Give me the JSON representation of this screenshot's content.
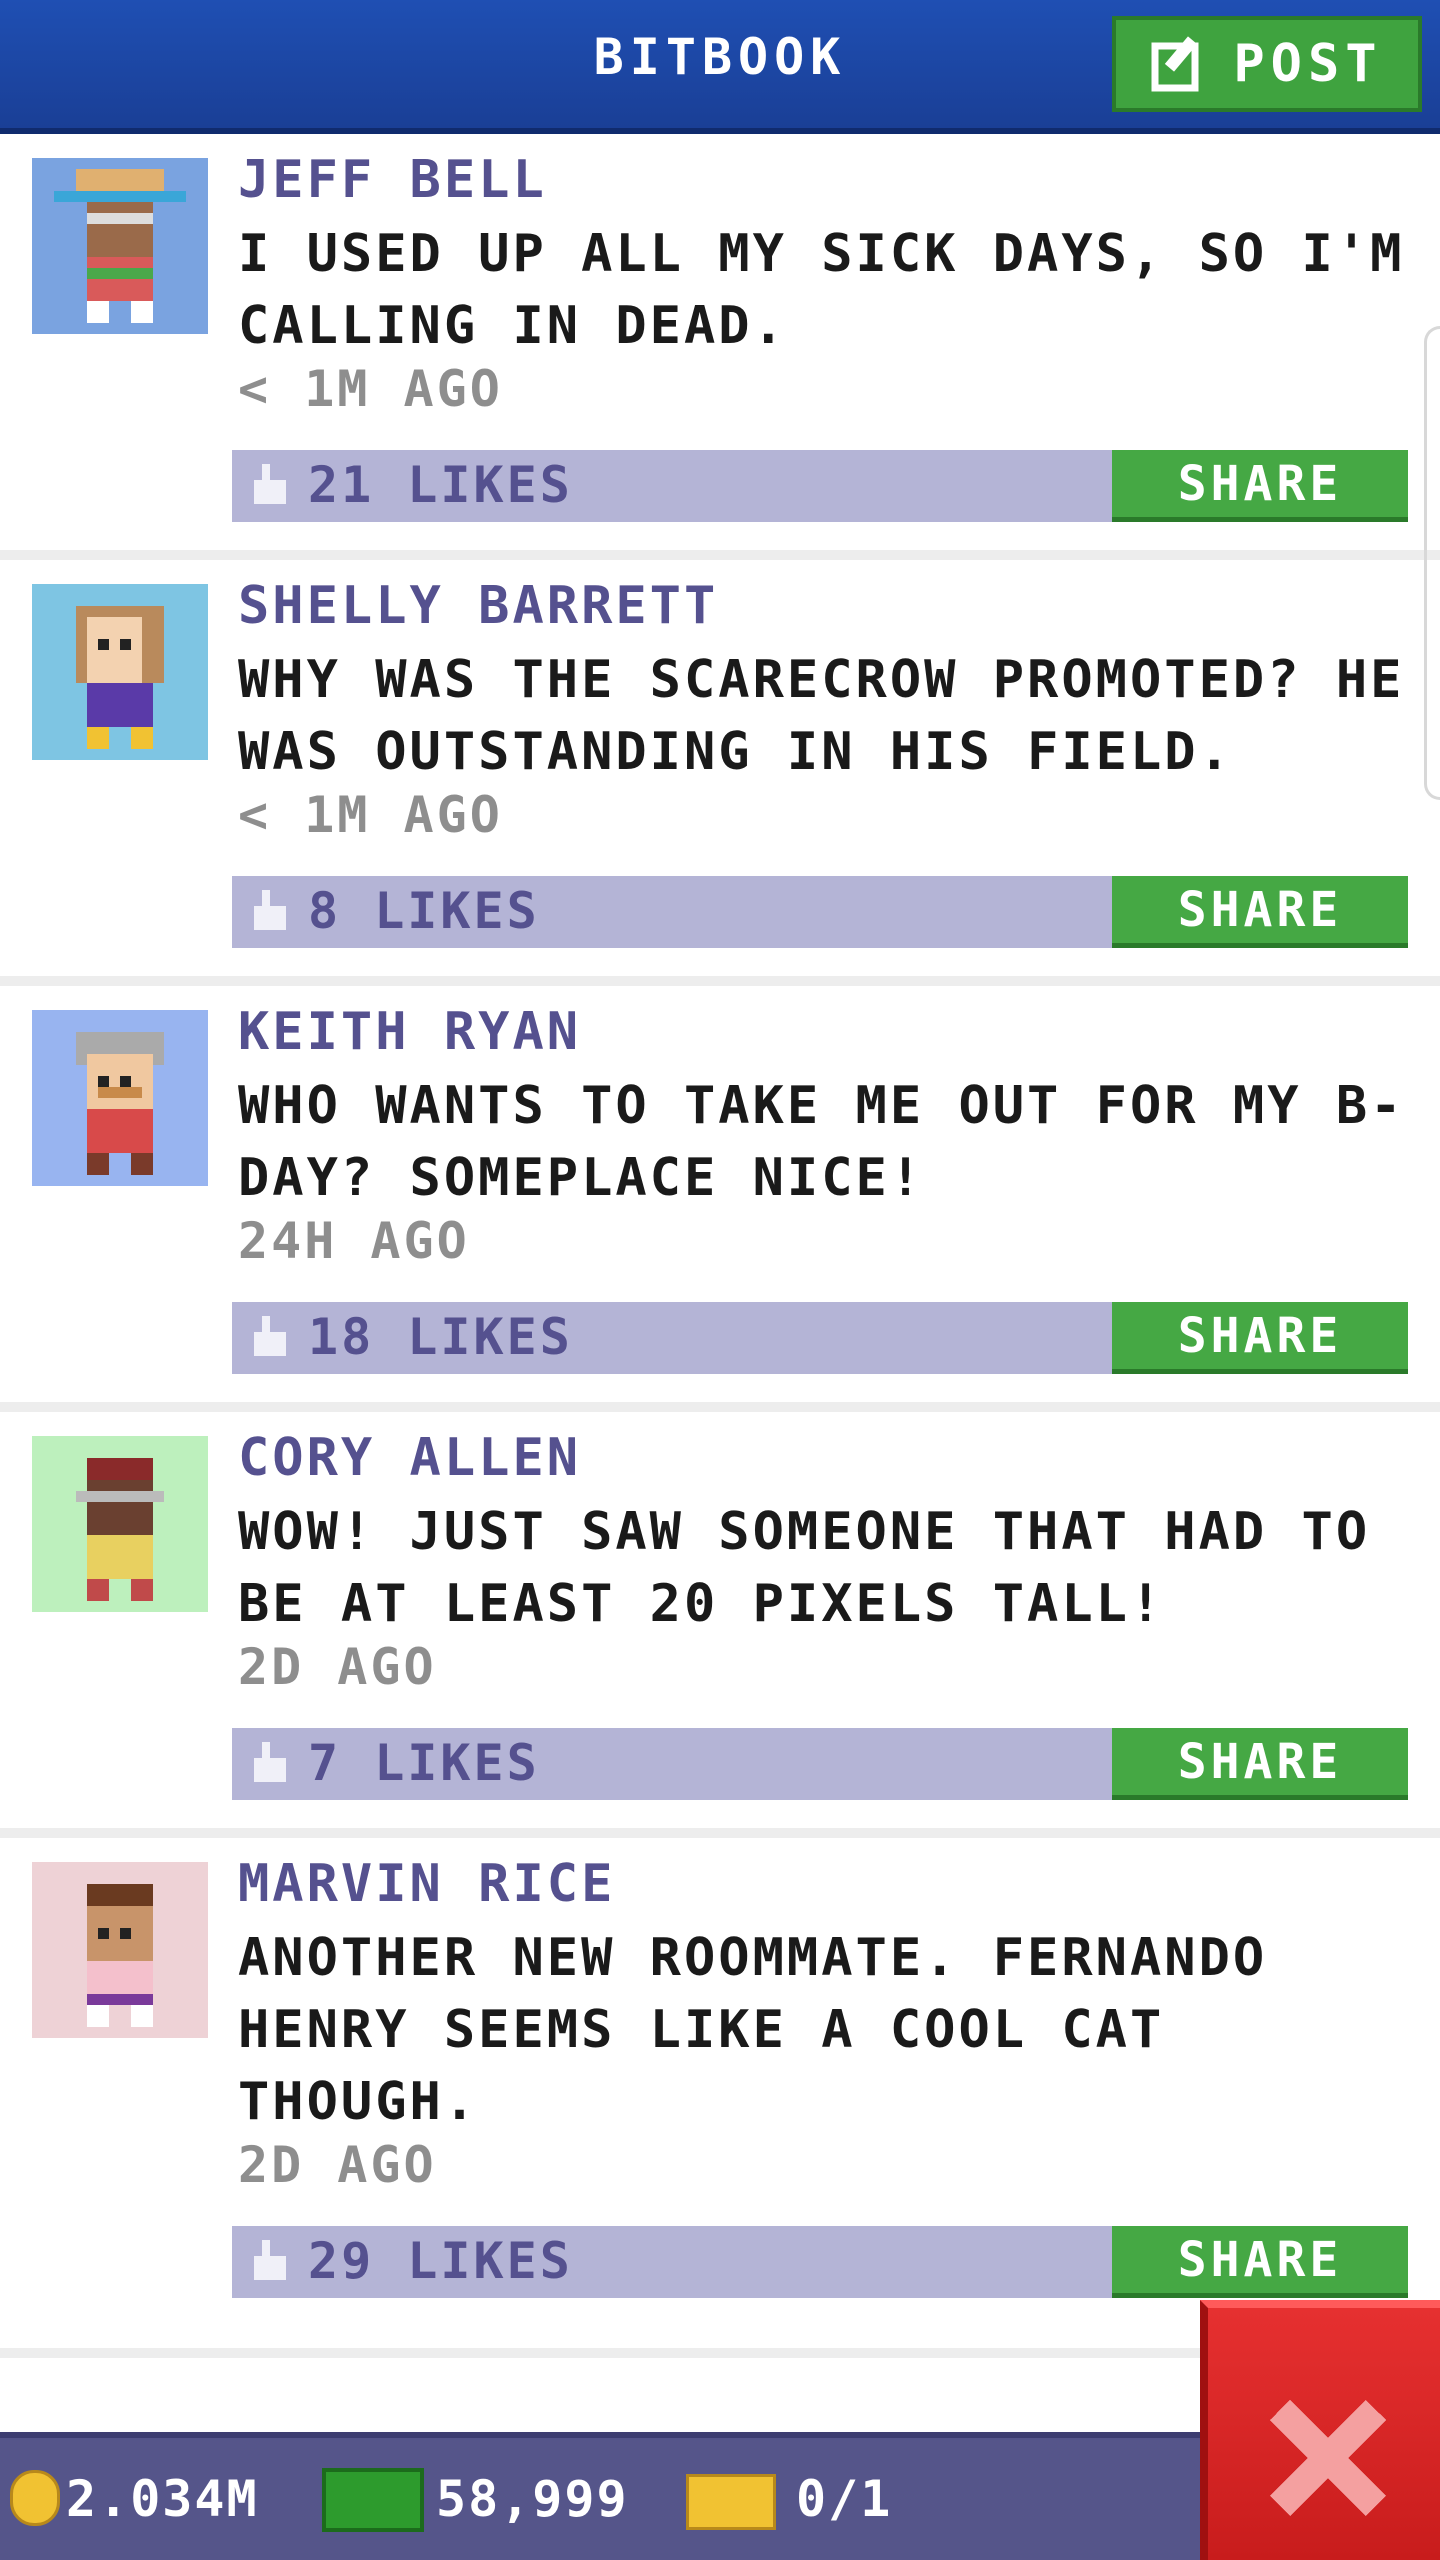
{
  "header": {
    "title": "BITBOOK",
    "post_label": "POST"
  },
  "posts": [
    {
      "name": "JEFF BELL",
      "message": "I USED UP ALL MY SICK DAYS, SO I'M CALLING IN DEAD.",
      "time": "< 1M AGO",
      "likes": "21 LIKES",
      "share": "SHARE"
    },
    {
      "name": "SHELLY BARRETT",
      "message": "WHY WAS THE SCARECROW PROMOTED? HE WAS OUTSTANDING IN HIS FIELD.",
      "time": "< 1M AGO",
      "likes": "8 LIKES",
      "share": "SHARE"
    },
    {
      "name": "KEITH RYAN",
      "message": "WHO WANTS TO TAKE ME OUT FOR MY B-DAY? SOMEPLACE NICE!",
      "time": "24H AGO",
      "likes": "18 LIKES",
      "share": "SHARE"
    },
    {
      "name": "CORY ALLEN",
      "message": "WOW! JUST SAW SOMEONE THAT HAD TO BE AT LEAST 20 PIXELS TALL!",
      "time": "2D AGO",
      "likes": "7 LIKES",
      "share": "SHARE"
    },
    {
      "name": "MARVIN RICE",
      "message": "ANOTHER NEW ROOMMATE. FERNANDO HENRY SEEMS LIKE A COOL CAT THOUGH.",
      "time": "2D AGO",
      "likes": "29 LIKES",
      "share": "SHARE"
    }
  ],
  "bottom_bar": {
    "coins": "2.034M",
    "bux": "58,999",
    "tickets": "0/1"
  },
  "colors": {
    "header": "#1f4fb3",
    "post_button": "#3fa33f",
    "likebar": "#b4b4d6",
    "name_text": "#55518f",
    "close_button": "#e63030"
  },
  "icons": {
    "post": "edit-icon",
    "like": "thumbs-up-icon",
    "coin": "coin-icon",
    "cash": "cash-icon",
    "ticket": "ticket-icon",
    "close": "close-icon"
  }
}
